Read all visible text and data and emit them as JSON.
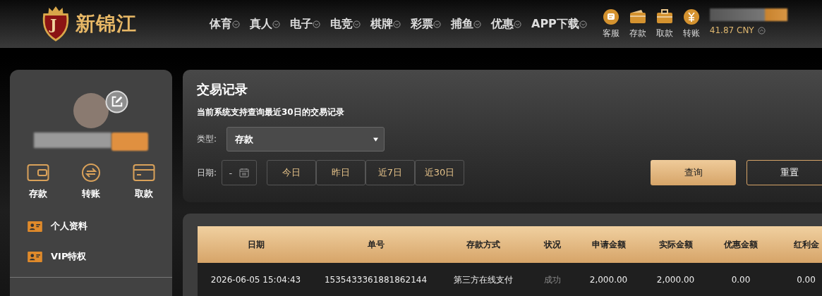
{
  "header": {
    "logo": {
      "badge_letter": "J",
      "text": "新锦江"
    },
    "nav": [
      {
        "label": "体育"
      },
      {
        "label": "真人"
      },
      {
        "label": "电子"
      },
      {
        "label": "电竞"
      },
      {
        "label": "棋牌"
      },
      {
        "label": "彩票"
      },
      {
        "label": "捕鱼"
      },
      {
        "label": "优惠"
      },
      {
        "label": "APP下载"
      }
    ],
    "actions": [
      {
        "label": "客服",
        "kind": "chat"
      },
      {
        "label": "存款",
        "kind": "wallet"
      },
      {
        "label": "取款",
        "kind": "case"
      },
      {
        "label": "转账",
        "kind": "yuan"
      }
    ],
    "balance": "41.87 CNY"
  },
  "sidebar": {
    "quick_actions": [
      {
        "label": "存款",
        "kind": "wallet"
      },
      {
        "label": "转账",
        "kind": "transfer"
      },
      {
        "label": "取款",
        "kind": "card"
      }
    ],
    "menu": [
      {
        "label": "个人资料"
      },
      {
        "label": "VIP特权"
      }
    ]
  },
  "filter": {
    "title": "交易记录",
    "notice": "当前系统支持查询最近30日的交易记录",
    "type_label": "类型:",
    "type_value": "存款",
    "date_label": "日期:",
    "date_value": "-",
    "ranges": [
      {
        "label": "今日"
      },
      {
        "label": "昨日"
      },
      {
        "label": "近7日"
      },
      {
        "label": "近30日"
      }
    ],
    "buttons": [
      {
        "label": "查询",
        "kind": "primary"
      },
      {
        "label": "重置",
        "kind": "secondary"
      }
    ]
  },
  "table": {
    "columns": [
      "日期",
      "单号",
      "存款方式",
      "状况",
      "申请金额",
      "实际金额",
      "优惠金额",
      "红利金"
    ],
    "rows": [
      {
        "date": "2026-06-05 15:04:43",
        "order_no": "1535433361881862144",
        "method": "第三方在线支付",
        "status": "成功",
        "requested": "2,000.00",
        "actual": "2,000.00",
        "discount": "0.00",
        "bonus": "0.00"
      }
    ]
  }
}
